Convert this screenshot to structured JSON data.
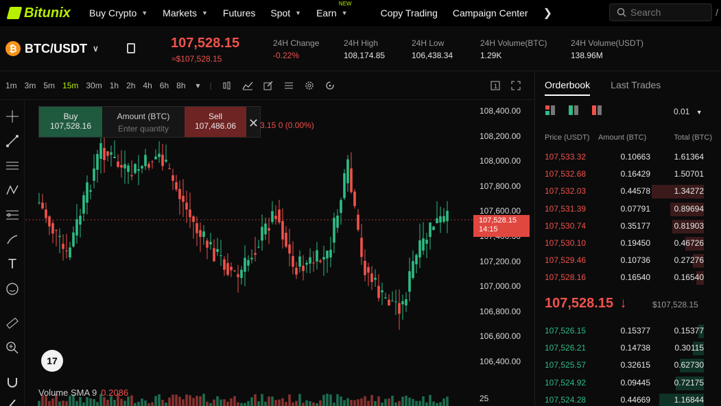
{
  "nav": {
    "logo": "Bitunix",
    "items": [
      {
        "label": "Buy Crypto",
        "chevron": true
      },
      {
        "label": "Markets",
        "chevron": true
      },
      {
        "label": "Futures",
        "chevron": false
      },
      {
        "label": "Spot",
        "chevron": true
      },
      {
        "label": "Earn",
        "chevron": true,
        "badge": "NEW"
      },
      {
        "label": "Copy Trading",
        "chevron": false
      },
      {
        "label": "Campaign Center",
        "chevron": false
      }
    ],
    "more_icon": "chevron-right-icon",
    "search_placeholder": "Search",
    "search_shortcut": "/"
  },
  "ticker": {
    "pair": "BTC/USDT",
    "coin_symbol": "₿",
    "last_price": "107,528.15",
    "last_price_fiat": "≈$107,528.15",
    "stats": [
      {
        "label": "24H Change",
        "value": "-0.22%",
        "negative": true
      },
      {
        "label": "24H High",
        "value": "108,174.85"
      },
      {
        "label": "24H Low",
        "value": "106,438.34"
      },
      {
        "label": "24H Volume(BTC)",
        "value": "1.29K"
      },
      {
        "label": "24H Volume(USDT)",
        "value": "138.96M"
      }
    ]
  },
  "toolbar": {
    "timeframes": [
      "1m",
      "3m",
      "5m",
      "15m",
      "30m",
      "1h",
      "2h",
      "4h",
      "6h",
      "8h"
    ],
    "active_timeframe": "15m",
    "more_chevron": "▾"
  },
  "order_panel": {
    "buy_label": "Buy",
    "buy_price": "107,528.16",
    "amount_label": "Amount (BTC)",
    "amount_placeholder": "Enter quantity",
    "sell_label": "Sell",
    "sell_price": "107,486.06"
  },
  "chart": {
    "legend_fragment": "3.15  0 (0.00%)",
    "price_axis": [
      "108,400.00",
      "108,200.00",
      "108,000.00",
      "107,800.00",
      "107,600.00",
      "107,400.00",
      "107,200.00",
      "107,000.00",
      "106,800.00",
      "106,600.00",
      "106,400.00"
    ],
    "current_price_tag": "107,528.15",
    "current_price_timer": "14:15",
    "volume_label": "Volume SMA 9",
    "volume_value": "0.2086",
    "volume_axis": "25",
    "tv_logo": "17",
    "colors": {
      "up": "#2ebd85",
      "down": "#f0524a"
    }
  },
  "orderbook": {
    "tabs": [
      "Orderbook",
      "Last Trades"
    ],
    "active_tab": "Orderbook",
    "precision": "0.01",
    "headers": [
      "Price (USDT)",
      "Amount (BTC)",
      "Total (BTC)"
    ],
    "asks": [
      {
        "price": "107,533.32",
        "amount": "0.10663",
        "total": "1.61364",
        "depth": 0.0
      },
      {
        "price": "107,532.68",
        "amount": "0.16429",
        "total": "1.50701",
        "depth": 0.0
      },
      {
        "price": "107,532.03",
        "amount": "0.44578",
        "total": "1.34272",
        "depth": 0.28
      },
      {
        "price": "107,531.39",
        "amount": "0.07791",
        "total": "0.89694",
        "depth": 0.18
      },
      {
        "price": "107,530.74",
        "amount": "0.35177",
        "total": "0.81903",
        "depth": 0.17
      },
      {
        "price": "107,530.10",
        "amount": "0.19450",
        "total": "0.46726",
        "depth": 0.1
      },
      {
        "price": "107,529.46",
        "amount": "0.10736",
        "total": "0.27276",
        "depth": 0.06
      },
      {
        "price": "107,528.16",
        "amount": "0.16540",
        "total": "0.16540",
        "depth": 0.04
      }
    ],
    "mid_price": "107,528.15",
    "mid_arrow": "↓",
    "mid_fiat": "$107,528.15",
    "bids": [
      {
        "price": "107,526.15",
        "amount": "0.15377",
        "total": "0.15377",
        "depth": 0.03
      },
      {
        "price": "107,526.21",
        "amount": "0.14738",
        "total": "0.30115",
        "depth": 0.06
      },
      {
        "price": "107,525.57",
        "amount": "0.32615",
        "total": "0.62730",
        "depth": 0.13
      },
      {
        "price": "107,524.92",
        "amount": "0.09445",
        "total": "0.72175",
        "depth": 0.15
      },
      {
        "price": "107,524.28",
        "amount": "0.44669",
        "total": "1.16844",
        "depth": 0.24
      }
    ]
  }
}
